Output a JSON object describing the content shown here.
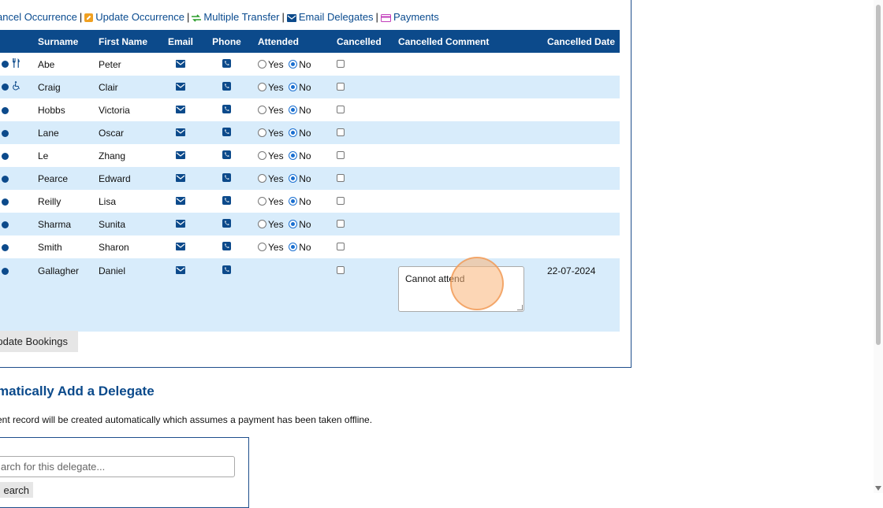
{
  "actions": [
    {
      "label": "ancel Occurrence",
      "icon": "none",
      "color": "#0a4b8f"
    },
    {
      "label": "Update Occurrence",
      "icon": "edit-icon",
      "color": "#f0a020"
    },
    {
      "label": "Multiple Transfer",
      "icon": "transfer-icon",
      "color": "#2a9d2a"
    },
    {
      "label": "Email Delegates",
      "icon": "envelope-icon",
      "color": "#0c4a8b"
    },
    {
      "label": "Payments",
      "icon": "credit-card-icon",
      "color": "#c23dbb"
    }
  ],
  "table": {
    "headers": [
      "Surname",
      "First Name",
      "Email",
      "Phone",
      "Attended",
      "Cancelled",
      "Cancelled Comment",
      "Cancelled Date"
    ],
    "rows": [
      {
        "surname": "Abe",
        "first": "Peter",
        "flag": "dietary-icon",
        "attended": "No",
        "cancelled": false,
        "comment": "",
        "date": ""
      },
      {
        "surname": "Craig",
        "first": "Clair",
        "flag": "wheelchair-icon",
        "attended": "No",
        "cancelled": false,
        "comment": "",
        "date": ""
      },
      {
        "surname": "Hobbs",
        "first": "Victoria",
        "flag": "",
        "attended": "No",
        "cancelled": false,
        "comment": "",
        "date": ""
      },
      {
        "surname": "Lane",
        "first": "Oscar",
        "flag": "",
        "attended": "No",
        "cancelled": false,
        "comment": "",
        "date": ""
      },
      {
        "surname": "Le",
        "first": "Zhang",
        "flag": "",
        "attended": "No",
        "cancelled": false,
        "comment": "",
        "date": ""
      },
      {
        "surname": "Pearce",
        "first": "Edward",
        "flag": "",
        "attended": "No",
        "cancelled": false,
        "comment": "",
        "date": ""
      },
      {
        "surname": "Reilly",
        "first": "Lisa",
        "flag": "",
        "attended": "No",
        "cancelled": false,
        "comment": "",
        "date": ""
      },
      {
        "surname": "Sharma",
        "first": "Sunita",
        "flag": "",
        "attended": "No",
        "cancelled": false,
        "comment": "",
        "date": ""
      },
      {
        "surname": "Smith",
        "first": "Sharon",
        "flag": "",
        "attended": "No",
        "cancelled": false,
        "comment": "",
        "date": ""
      },
      {
        "surname": "Gallagher",
        "first": "Daniel",
        "flag": "",
        "attended": "",
        "cancelled": false,
        "comment": "Cannot attend",
        "date": "22-07-2024"
      }
    ],
    "yes_label": "Yes",
    "no_label": "No"
  },
  "update_button": "pdate Bookings",
  "add_section": {
    "title": "matically Add a Delegate",
    "note": "ent record will be created automatically which assumes a payment has been taken offline.",
    "search_placeholder": "arch for this delegate...",
    "search_button": "earch"
  },
  "colors": {
    "header_bg": "#0c4a8b",
    "alt_row": "#d8ecfb",
    "heading": "#0b4a8b"
  }
}
